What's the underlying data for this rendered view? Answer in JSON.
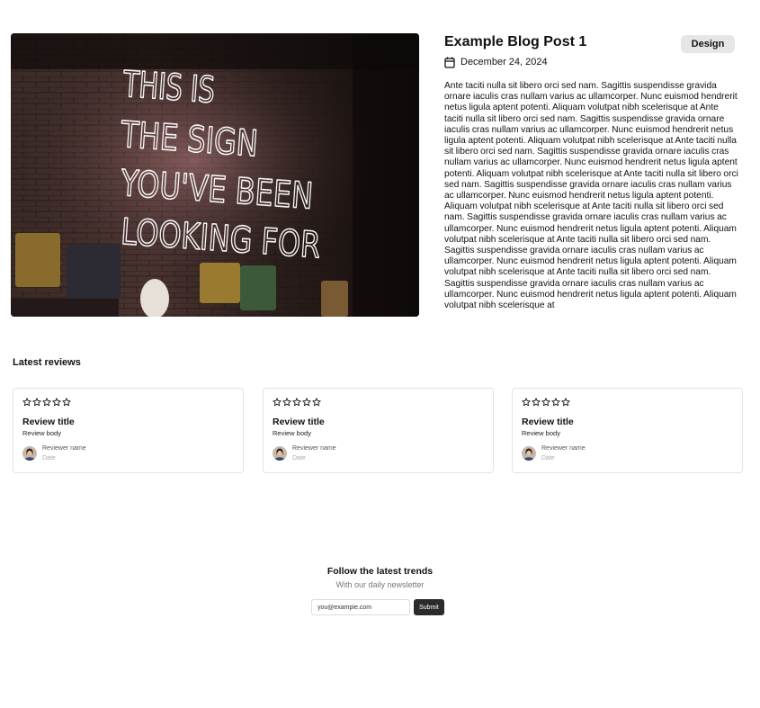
{
  "post": {
    "image_alt": "THIS IS THE SIGN YOU'VE BEEN LOOKING FOR",
    "title": "Example Blog Post 1",
    "tag": "Design",
    "date": "December 24, 2024",
    "body": "Ante taciti nulla sit libero orci sed nam. Sagittis suspendisse gravida ornare iaculis cras nullam varius ac ullamcorper. Nunc euismod hendrerit netus ligula aptent potenti. Aliquam volutpat nibh scelerisque at Ante taciti nulla sit libero orci sed nam. Sagittis suspendisse gravida ornare iaculis cras nullam varius ac ullamcorper. Nunc euismod hendrerit netus ligula aptent potenti. Aliquam volutpat nibh scelerisque at Ante taciti nulla sit libero orci sed nam. Sagittis suspendisse gravida ornare iaculis cras nullam varius ac ullamcorper. Nunc euismod hendrerit netus ligula aptent potenti. Aliquam volutpat nibh scelerisque at Ante taciti nulla sit libero orci sed nam. Sagittis suspendisse gravida ornare iaculis cras nullam varius ac ullamcorper. Nunc euismod hendrerit netus ligula aptent potenti. Aliquam volutpat nibh scelerisque at Ante taciti nulla sit libero orci sed nam. Sagittis suspendisse gravida ornare iaculis cras nullam varius ac ullamcorper. Nunc euismod hendrerit netus ligula aptent potenti. Aliquam volutpat nibh scelerisque at Ante taciti nulla sit libero orci sed nam. Sagittis suspendisse gravida ornare iaculis cras nullam varius ac ullamcorper. Nunc euismod hendrerit netus ligula aptent potenti. Aliquam volutpat nibh scelerisque at Ante taciti nulla sit libero orci sed nam. Sagittis suspendisse gravida ornare iaculis cras nullam varius ac ullamcorper. Nunc euismod hendrerit netus ligula aptent potenti. Aliquam volutpat nibh scelerisque at"
  },
  "reviews": {
    "heading": "Latest reviews",
    "items": [
      {
        "rating": 0,
        "title": "Review title",
        "body": "Review body",
        "reviewer": "Reviewer name",
        "date": "Date"
      },
      {
        "rating": 0,
        "title": "Review title",
        "body": "Review body",
        "reviewer": "Reviewer name",
        "date": "Date"
      },
      {
        "rating": 0,
        "title": "Review title",
        "body": "Review body",
        "reviewer": "Reviewer name",
        "date": "Date"
      }
    ]
  },
  "newsletter": {
    "title": "Follow the latest trends",
    "subtitle": "With our daily newsletter",
    "input_placeholder": "you@example.com",
    "submit_label": "Submit"
  },
  "colors": {
    "tag_bg": "#e6e6e6",
    "button_bg": "#2b2b2b",
    "card_border": "#e3e3e3"
  },
  "icons": {
    "date": "calendar-icon",
    "rating": "star-outline-icon"
  }
}
